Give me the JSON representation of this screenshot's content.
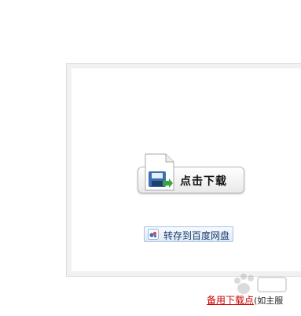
{
  "download_button": {
    "label": "点击下载",
    "icon": "floppy-disk-file-icon"
  },
  "save_to_disk_button": {
    "label": "转存到百度网盘",
    "icon": "baidu-cloud-icon"
  },
  "alt_download": {
    "link_label": "备用下载点",
    "note": "(如主服"
  },
  "watermark": {
    "icon": "baidu-paw-watermark-icon"
  },
  "colors": {
    "link_red": "#cc0000",
    "save_button_text": "#1a3d6e",
    "panel_border": "#dcdcdc"
  }
}
